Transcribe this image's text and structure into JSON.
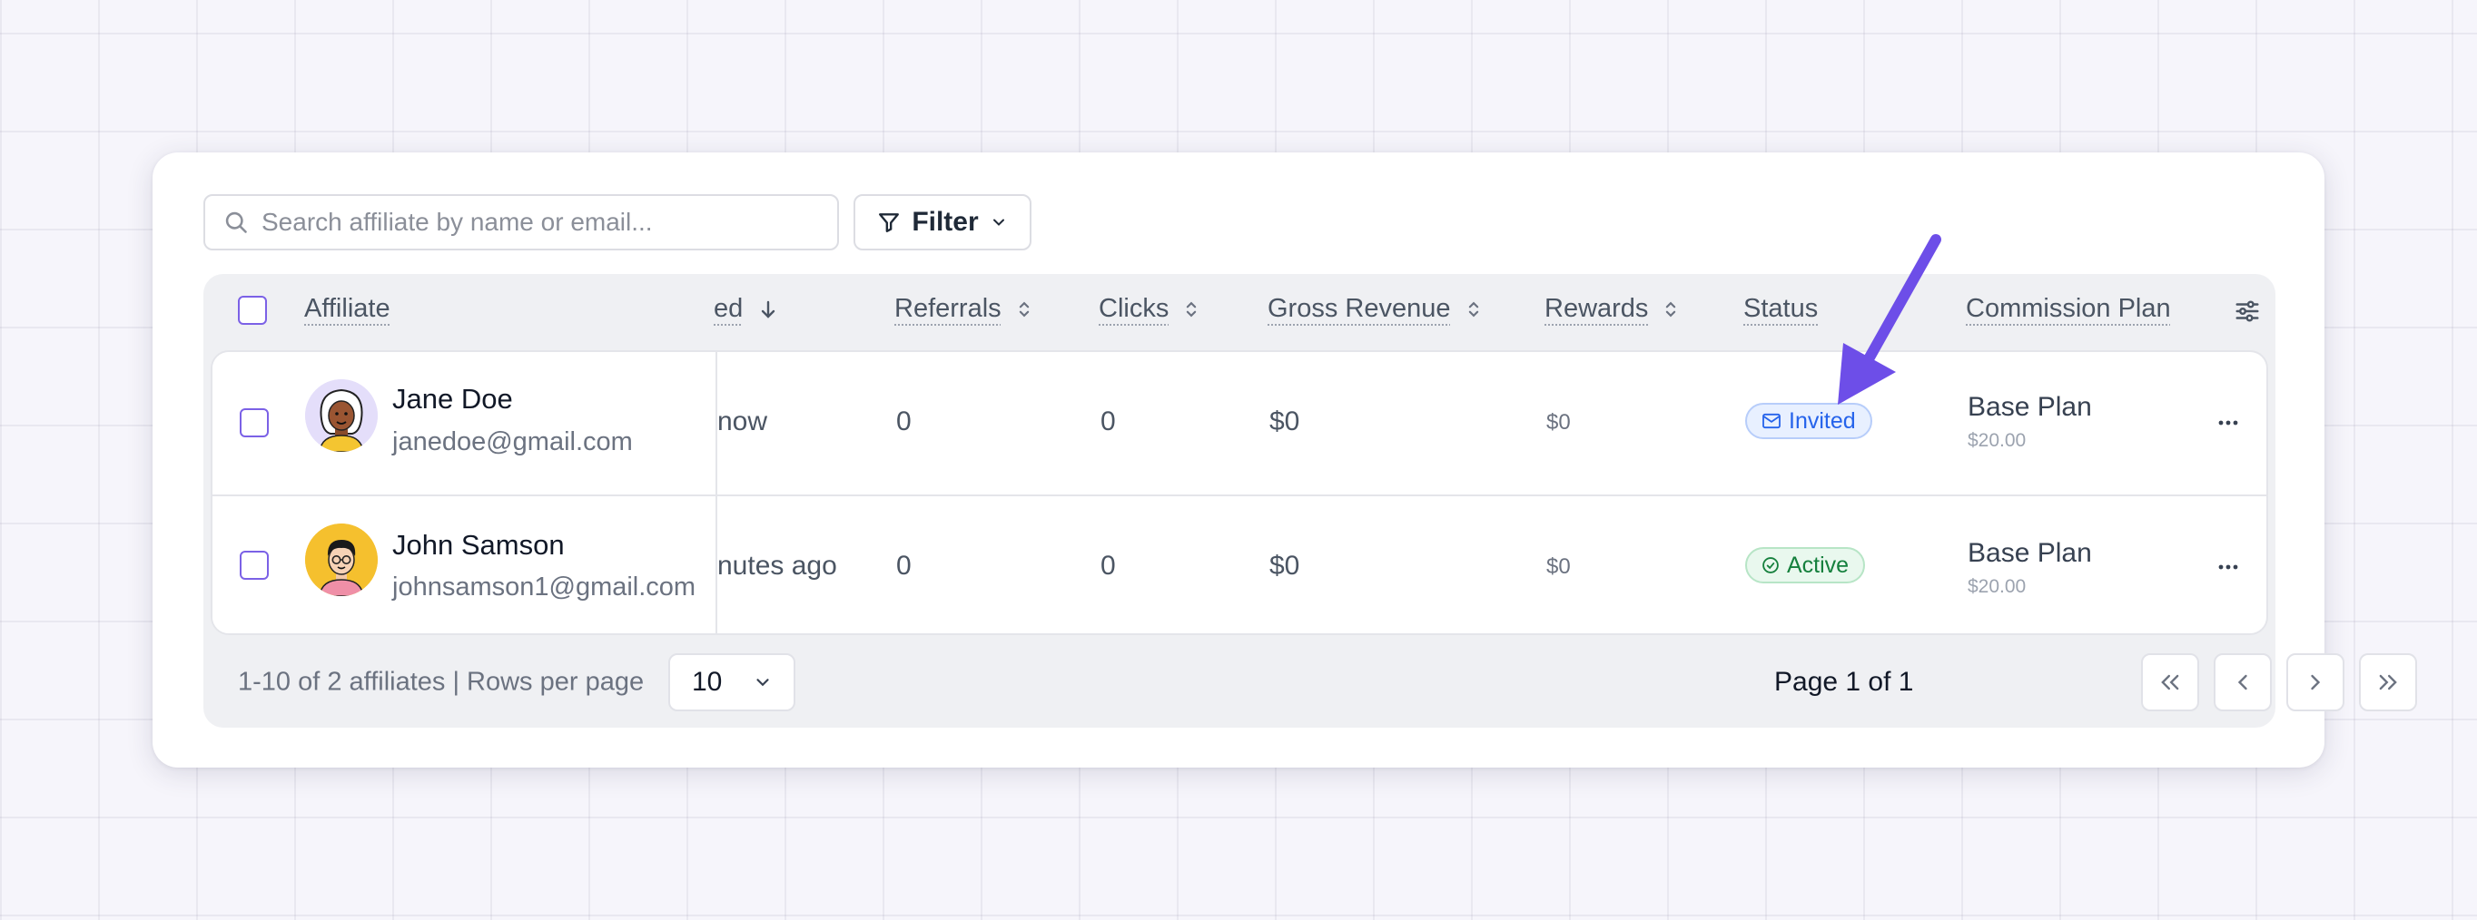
{
  "toolbar": {
    "search_placeholder": "Search affiliate by name or email...",
    "filter_label": "Filter"
  },
  "table": {
    "columns": {
      "affiliate": "Affiliate",
      "joined_partial": "ed",
      "referrals": "Referrals",
      "clicks": "Clicks",
      "gross_revenue": "Gross Revenue",
      "rewards": "Rewards",
      "status": "Status",
      "commission_plan": "Commission Plan"
    },
    "rows": [
      {
        "name": "Jane Doe",
        "email": "janedoe@gmail.com",
        "joined": "now",
        "referrals": "0",
        "clicks": "0",
        "gross_revenue": "$0",
        "rewards": "$0",
        "status": "Invited",
        "plan": "Base Plan",
        "plan_price": "$20.00"
      },
      {
        "name": "John Samson",
        "email": "johnsamson1@gmail.com",
        "joined": "nutes ago",
        "referrals": "0",
        "clicks": "0",
        "gross_revenue": "$0",
        "rewards": "$0",
        "status": "Active",
        "plan": "Base Plan",
        "plan_price": "$20.00"
      }
    ]
  },
  "footer": {
    "summary": "1-10 of 2 affiliates | Rows per page",
    "rows_per_page": "10",
    "page_label": "Page 1 of 1"
  },
  "colors": {
    "accent": "#7b61e6",
    "annotation_arrow": "#6d4ee8",
    "invited": "#2563eb",
    "active": "#15803d"
  }
}
